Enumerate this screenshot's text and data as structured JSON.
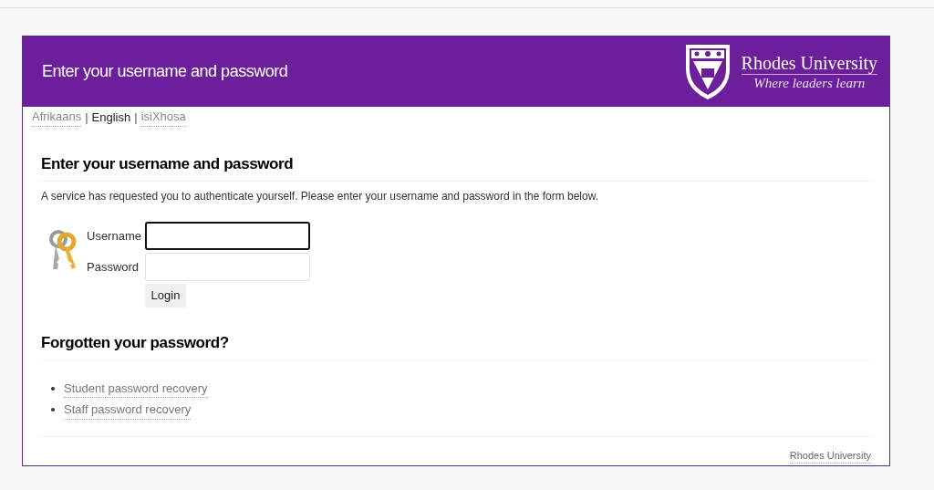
{
  "header": {
    "title": "Enter your username and password",
    "logo_name": "Rhodes University",
    "logo_tagline": "Where leaders learn"
  },
  "languages": [
    {
      "label": "Afrikaans",
      "selected": false
    },
    {
      "label": "English",
      "selected": true
    },
    {
      "label": "isiXhosa",
      "selected": false
    }
  ],
  "language_separator": "|",
  "login": {
    "heading": "Enter your username and password",
    "intro": "A service has requested you to authenticate yourself. Please enter your username and password in the form below.",
    "fields": [
      {
        "label": "Username",
        "focused": true
      },
      {
        "label": "Password",
        "focused": false
      }
    ],
    "button": "Login"
  },
  "forgotten": {
    "heading": "Forgotten your password?",
    "links": [
      "Student password recovery",
      "Staff password recovery"
    ]
  },
  "footer": "Rhodes University"
}
